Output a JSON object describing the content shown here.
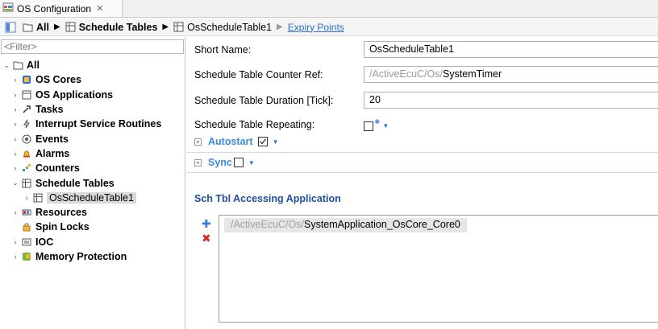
{
  "editor_tab": {
    "title": "OS Configuration",
    "close": "✕"
  },
  "breadcrumb": {
    "all": "All",
    "schedule_tables": "Schedule Tables",
    "current": "OsScheduleTable1",
    "link": "Expiry Points"
  },
  "filter": {
    "placeholder": "<Filter>"
  },
  "tree": {
    "root": "All",
    "items": [
      {
        "label": "OS Cores",
        "icon": "cpu-icon"
      },
      {
        "label": "OS Applications",
        "icon": "app-icon"
      },
      {
        "label": "Tasks",
        "icon": "task-icon"
      },
      {
        "label": "Interrupt Service Routines",
        "icon": "isr-icon"
      },
      {
        "label": "Events",
        "icon": "event-icon"
      },
      {
        "label": "Alarms",
        "icon": "bell-icon"
      },
      {
        "label": "Counters",
        "icon": "counter-icon"
      },
      {
        "label": "Schedule Tables",
        "icon": "table-icon"
      },
      {
        "label": "OsScheduleTable1",
        "icon": "table-icon"
      },
      {
        "label": "Resources",
        "icon": "resource-icon"
      },
      {
        "label": "Spin Locks",
        "icon": "lock-icon"
      },
      {
        "label": "IOC",
        "icon": "ioc-icon"
      },
      {
        "label": "Memory Protection",
        "icon": "shield-icon"
      }
    ]
  },
  "form": {
    "short_name_label": "Short Name:",
    "short_name_value": "OsScheduleTable1",
    "counter_ref_label": "Schedule Table Counter Ref:",
    "counter_ref_prefix": "/ActiveEcuC/Os/",
    "counter_ref_value": "SystemTimer",
    "duration_label": "Schedule Table Duration [Tick]:",
    "duration_value": "20",
    "repeating_label": "Schedule Table Repeating:"
  },
  "sections": {
    "autostart": "Autostart",
    "sync": "Sync"
  },
  "accessing": {
    "title": "Sch Tbl Accessing Application",
    "item_prefix": "/ActiveEcuC/Os/",
    "item_value": "SystemApplication_OsCore_Core0"
  },
  "colors": {
    "link": "#2f6fd6",
    "section_blue": "#3c8ae0",
    "title_blue": "#1f4f9e",
    "delete_red": "#d0312d"
  }
}
